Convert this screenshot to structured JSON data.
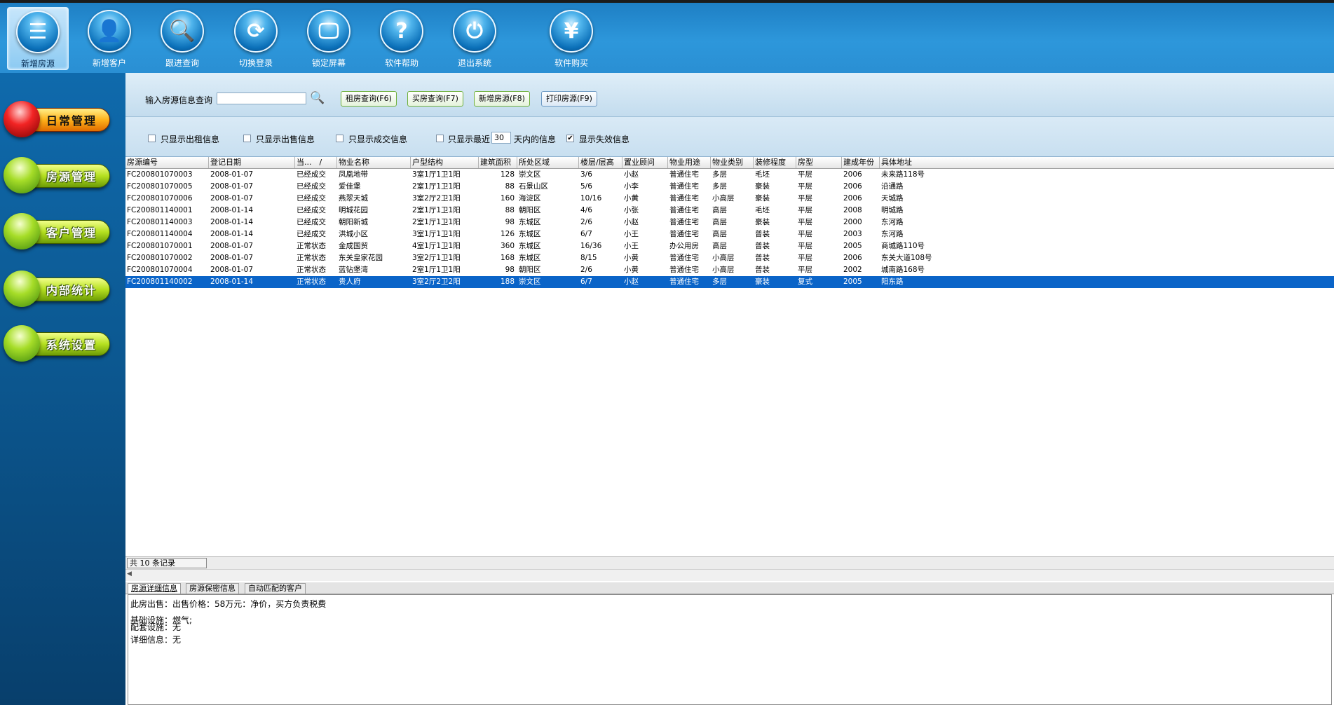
{
  "toolbar": {
    "items": [
      {
        "label": "新增房源",
        "icon": "document-icon",
        "glyph": "☰"
      },
      {
        "label": "新增客户",
        "icon": "user-icon",
        "glyph": "👤"
      },
      {
        "label": "跟进查询",
        "icon": "magnifier-icon",
        "glyph": "🔍"
      },
      {
        "label": "切换登录",
        "icon": "refresh-icon",
        "glyph": "⟳"
      },
      {
        "label": "锁定屏幕",
        "icon": "monitor-lock-icon",
        "glyph": "🖵"
      },
      {
        "label": "软件帮助",
        "icon": "help-icon",
        "glyph": "?"
      },
      {
        "label": "退出系统",
        "icon": "power-icon",
        "glyph": "⏻"
      },
      {
        "label": "软件购买",
        "icon": "yen-icon",
        "glyph": "¥"
      }
    ]
  },
  "sidebar": {
    "items": [
      {
        "label": "日常管理"
      },
      {
        "label": "房源管理"
      },
      {
        "label": "客户管理"
      },
      {
        "label": "内部统计"
      },
      {
        "label": "系统设置"
      }
    ]
  },
  "search": {
    "label": "输入房源信息查询",
    "value": "",
    "buttons": [
      "租房查询(F6)",
      "买房查询(F7)",
      "新增房源(F8)",
      "打印房源(F9)"
    ]
  },
  "filters": {
    "rent_only": "只显示出租信息",
    "sale_only": "只显示出售信息",
    "deal_only": "只显示成交信息",
    "recent_prefix": "只显示最近",
    "recent_days": "30",
    "recent_suffix": "天内的信息",
    "show_invalid": "显示失效信息",
    "show_invalid_checked": "✔"
  },
  "grid": {
    "columns": [
      "房源编号",
      "登记日期",
      "当...　/",
      "物业名称",
      "户型结构",
      "建筑面积",
      "所处区域",
      "楼层/层高",
      "置业顾问",
      "物业用途",
      "物业类别",
      "装修程度",
      "房型",
      "建成年份",
      "具体地址"
    ],
    "rows": [
      [
        "FC200801070003",
        "2008-01-07",
        "已经成交",
        "凤凰地带",
        "3室1厅1卫1阳",
        "128",
        "崇文区",
        "3/6",
        "小赵",
        "普通住宅",
        "多层",
        "毛坯",
        "平层",
        "2006",
        "未来路118号"
      ],
      [
        "FC200801070005",
        "2008-01-07",
        "已经成交",
        "爱佳堡",
        "2室1厅1卫1阳",
        "88",
        "石景山区",
        "5/6",
        "小李",
        "普通住宅",
        "多层",
        "豪装",
        "平层",
        "2006",
        "沿通路"
      ],
      [
        "FC200801070006",
        "2008-01-07",
        "已经成交",
        "燕翠天城",
        "3室2厅2卫1阳",
        "160",
        "海淀区",
        "10/16",
        "小黄",
        "普通住宅",
        "小高层",
        "豪装",
        "平层",
        "2006",
        "天城路"
      ],
      [
        "FC200801140001",
        "2008-01-14",
        "已经成交",
        "明城花园",
        "2室1厅1卫1阳",
        "88",
        "朝阳区",
        "4/6",
        "小张",
        "普通住宅",
        "高层",
        "毛坯",
        "平层",
        "2008",
        "明城路"
      ],
      [
        "FC200801140003",
        "2008-01-14",
        "已经成交",
        "朝阳新城",
        "2室1厅1卫1阳",
        "98",
        "东城区",
        "2/6",
        "小赵",
        "普通住宅",
        "高层",
        "豪装",
        "平层",
        "2000",
        "东河路"
      ],
      [
        "FC200801140004",
        "2008-01-14",
        "已经成交",
        "洪城小区",
        "3室1厅1卫1阳",
        "126",
        "东城区",
        "6/7",
        "小王",
        "普通住宅",
        "高层",
        "普装",
        "平层",
        "2003",
        "东河路"
      ],
      [
        "FC200801070001",
        "2008-01-07",
        "正常状态",
        "金成国贸",
        "4室1厅1卫1阳",
        "360",
        "东城区",
        "16/36",
        "小王",
        "办公用房",
        "高层",
        "普装",
        "平层",
        "2005",
        "商城路110号"
      ],
      [
        "FC200801070002",
        "2008-01-07",
        "正常状态",
        "东关皇家花园",
        "3室2厅1卫1阳",
        "168",
        "东城区",
        "8/15",
        "小黄",
        "普通住宅",
        "小高层",
        "普装",
        "平层",
        "2006",
        "东关大道108号"
      ],
      [
        "FC200801070004",
        "2008-01-07",
        "正常状态",
        "蓝钻堡湾",
        "2室1厅1卫1阳",
        "98",
        "朝阳区",
        "2/6",
        "小黄",
        "普通住宅",
        "小高层",
        "普装",
        "平层",
        "2002",
        "城南路168号"
      ],
      [
        "FC200801140002",
        "2008-01-14",
        "正常状态",
        "贵人府",
        "3室2厅2卫2阳",
        "188",
        "崇文区",
        "6/7",
        "小赵",
        "普通住宅",
        "多层",
        "豪装",
        "复式",
        "2005",
        "阳东路"
      ]
    ],
    "count_text": "共 10 条记录"
  },
  "tabs": [
    "房源详细信息",
    "房源保密信息",
    "自动匹配的客户"
  ],
  "detail": {
    "sale": "此房出售：出售价格：58万元：净价，买方负责税费",
    "basic": "基础设施：燃气;",
    "support": "配套设施：无",
    "info": "详细信息：无"
  }
}
